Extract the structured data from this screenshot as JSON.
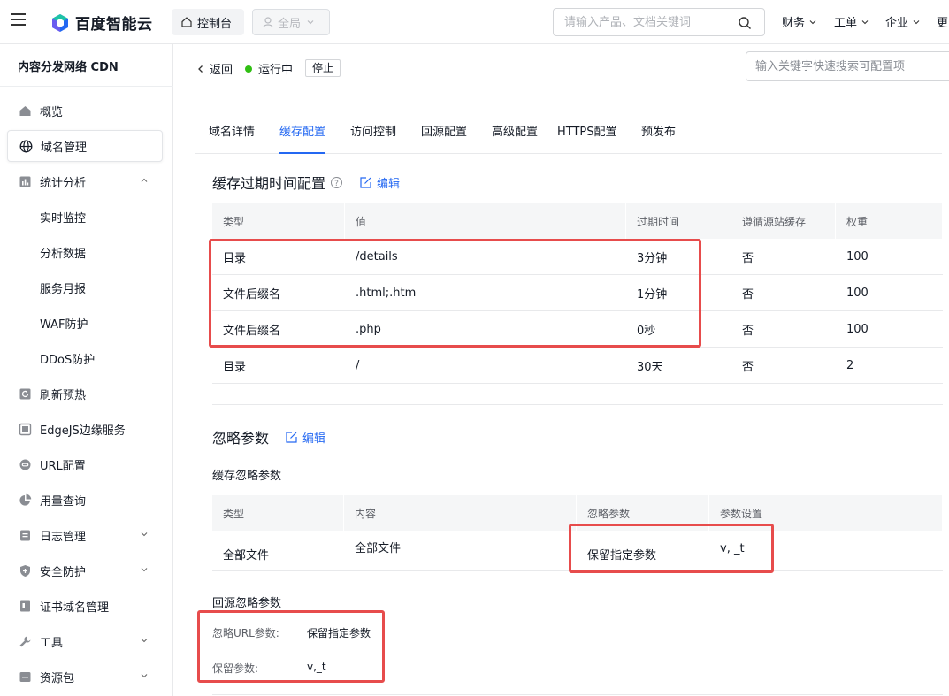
{
  "topbar": {
    "brand": "百度智能云",
    "console": "控制台",
    "scope": "全局",
    "search_placeholder": "请输入产品、文档关键词",
    "nav": [
      "财务",
      "工单",
      "企业",
      "更"
    ]
  },
  "sidebar": {
    "title": "内容分发网络 CDN",
    "items": [
      {
        "label": "概览",
        "icon": "home-icon"
      },
      {
        "label": "域名管理",
        "icon": "globe-icon"
      },
      {
        "label": "统计分析",
        "icon": "chart-icon"
      },
      {
        "label": "实时监控"
      },
      {
        "label": "分析数据"
      },
      {
        "label": "服务月报"
      },
      {
        "label": "WAF防护"
      },
      {
        "label": "DDoS防护"
      },
      {
        "label": "刷新预热",
        "icon": "refresh-icon"
      },
      {
        "label": "EdgeJS边缘服务",
        "icon": "edge-icon"
      },
      {
        "label": "URL配置",
        "icon": "link-icon"
      },
      {
        "label": "用量查询",
        "icon": "pie-icon"
      },
      {
        "label": "日志管理",
        "icon": "log-icon"
      },
      {
        "label": "安全防护",
        "icon": "shield-icon"
      },
      {
        "label": "证书域名管理",
        "icon": "certificate-icon"
      },
      {
        "label": "工具",
        "icon": "wrench-icon"
      },
      {
        "label": "资源包",
        "icon": "package-icon"
      }
    ]
  },
  "header": {
    "back": "返回",
    "status": "运行中",
    "stop": "停止",
    "search_placeholder": "输入关键字快速搜索可配置项"
  },
  "tabs": [
    "域名详情",
    "缓存配置",
    "访问控制",
    "回源配置",
    "高级配置",
    "HTTPS配置",
    "预发布"
  ],
  "cache_expiry": {
    "title": "缓存过期时间配置",
    "edit": "编辑",
    "columns": [
      "类型",
      "值",
      "过期时间",
      "遵循源站缓存",
      "权重"
    ],
    "rows": [
      [
        "目录",
        "/details",
        "3分钟",
        "否",
        "100"
      ],
      [
        "文件后缀名",
        ".html;.htm",
        "1分钟",
        "否",
        "100"
      ],
      [
        "文件后缀名",
        ".php",
        "0秒",
        "否",
        "100"
      ],
      [
        "目录",
        "/",
        "30天",
        "否",
        "2"
      ]
    ]
  },
  "ignore_params": {
    "title": "忽略参数",
    "edit": "编辑",
    "cache_title": "缓存忽略参数",
    "columns": [
      "类型",
      "内容",
      "忽略参数",
      "参数设置"
    ],
    "row": [
      "全部文件",
      "全部文件",
      "保留指定参数",
      "v, _t"
    ],
    "origin_title": "回源忽略参数",
    "origin_url_label": "忽略URL参数:",
    "origin_url_value": "保留指定参数",
    "origin_keep_label": "保留参数:",
    "origin_keep_value": "v,_t"
  },
  "colors": {
    "accent": "#2468f2",
    "status": "#30bf13",
    "highlight": "#e74c4c"
  }
}
